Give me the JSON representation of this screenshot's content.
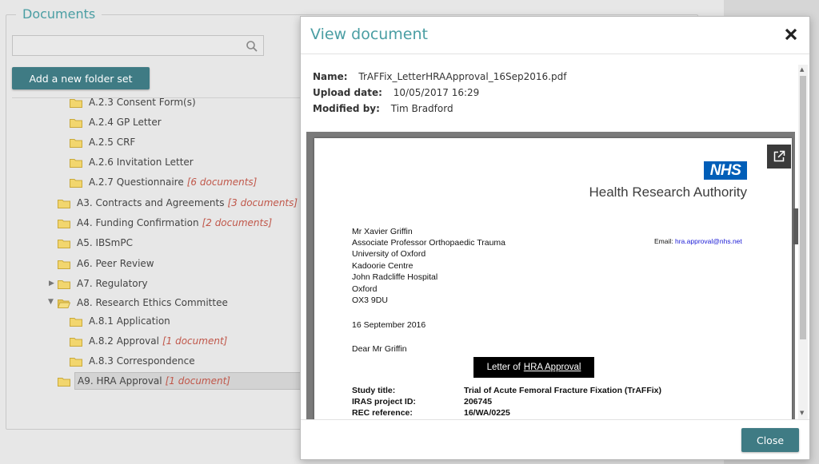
{
  "documents_panel": {
    "legend": "Documents",
    "search_placeholder": "",
    "add_folder_button": "Add a new folder set",
    "tree": [
      {
        "label": "A.2.3 Consent Form(s)",
        "count": ""
      },
      {
        "label": "A.2.4 GP Letter",
        "count": ""
      },
      {
        "label": "A.2.5 CRF",
        "count": ""
      },
      {
        "label": "A.2.6 Invitation Letter",
        "count": ""
      },
      {
        "label": "A.2.7 Questionnaire",
        "count": "[6 documents]"
      },
      {
        "label": "A3. Contracts and Agreements",
        "count": "[3 documents]"
      },
      {
        "label": "A4. Funding Confirmation",
        "count": "[2 documents]"
      },
      {
        "label": "A5. IBSmPC",
        "count": ""
      },
      {
        "label": "A6. Peer Review",
        "count": ""
      },
      {
        "label": "A7. Regulatory",
        "count": ""
      },
      {
        "label": "A8. Research Ethics Committee",
        "count": ""
      },
      {
        "label": "A.8.1 Application",
        "count": ""
      },
      {
        "label": "A.8.2 Approval",
        "count": "[1 document]"
      },
      {
        "label": "A.8.3 Correspondence",
        "count": ""
      },
      {
        "label": "A9. HRA Approval",
        "count": "[1 document]"
      }
    ]
  },
  "modal": {
    "title": "View document",
    "name_label": "Name:",
    "name_value": "TrAFFix_LetterHRAApproval_16Sep2016.pdf",
    "upload_label": "Upload date:",
    "upload_value": "10/05/2017 16:29",
    "modified_label": "Modified by:",
    "modified_value": "Tim Bradford",
    "close_button": "Close"
  },
  "pdf": {
    "logo": "NHS",
    "org": "Health Research Authority",
    "address": [
      "Mr Xavier Griffin",
      "Associate Professor Orthopaedic Trauma",
      "University of Oxford",
      "Kadoorie Centre",
      "John Radcliffe Hospital",
      "Oxford",
      "OX3 9DU"
    ],
    "email_label": "Email:",
    "email": "hra.approval@nhs.net",
    "date": "16 September 2016",
    "salutation": "Dear Mr Griffin",
    "letter_of": "Letter of",
    "letter_link": "HRA Approval",
    "study_title_label": "Study title:",
    "study_title": "Trial of Acute Femoral Fracture Fixation (TrAFFix)",
    "iras_label": "IRAS project ID:",
    "iras": "206745",
    "rec_label": "REC reference:",
    "rec": "16/WA/0225"
  },
  "colors": {
    "accent": "#4a9ea3",
    "button": "#3f7b84",
    "count": "#c0574a",
    "nhs_blue": "#005eb8"
  }
}
